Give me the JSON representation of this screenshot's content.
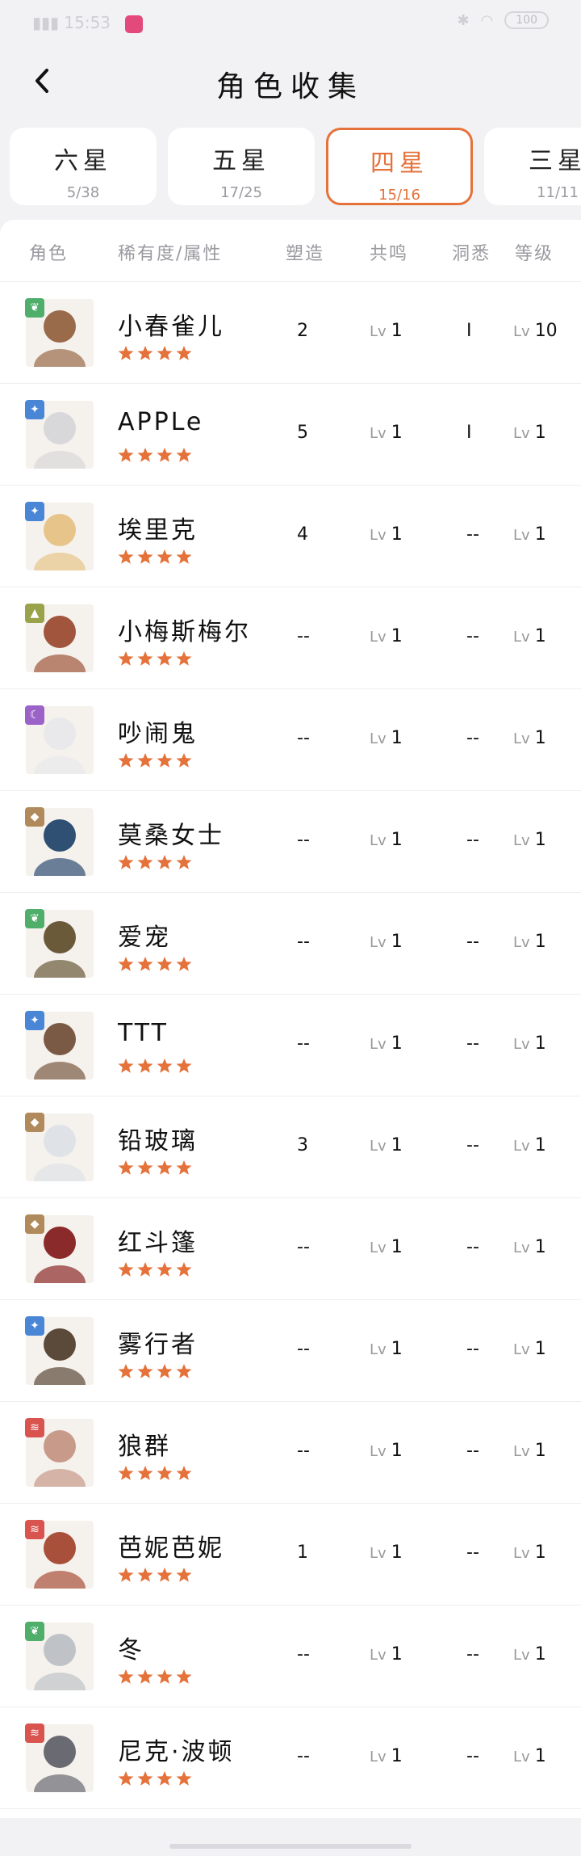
{
  "status_bar": {
    "time": "15:53",
    "battery": "100"
  },
  "header": {
    "title": "角色收集"
  },
  "tabs": [
    {
      "name": "六星",
      "count": "5/38",
      "active": false
    },
    {
      "name": "五星",
      "count": "17/25",
      "active": false
    },
    {
      "name": "四星",
      "count": "15/16",
      "active": true
    },
    {
      "name": "三星",
      "count": "11/11",
      "active": false
    }
  ],
  "table": {
    "headers": [
      "角色",
      "稀有度/属性",
      "塑造",
      "共鸣",
      "洞悉",
      "等级"
    ],
    "rows": [
      {
        "name": "小春雀儿",
        "attr": "plant",
        "attr_color": "#4fae6a",
        "portrait_color": "#9a6b4a",
        "shape": "2",
        "resonance": "1",
        "insight": "I",
        "level": "10"
      },
      {
        "name": "APPLe",
        "attr": "star",
        "attr_color": "#4a86d6",
        "portrait_color": "#d8d8da",
        "shape": "5",
        "resonance": "1",
        "insight": "I",
        "level": "1"
      },
      {
        "name": "埃里克",
        "attr": "star",
        "attr_color": "#4a86d6",
        "portrait_color": "#e7c48a",
        "shape": "4",
        "resonance": "1",
        "insight": "--",
        "level": "1"
      },
      {
        "name": "小梅斯梅尔",
        "attr": "rock",
        "attr_color": "#9aa24a",
        "portrait_color": "#a0553c",
        "shape": "--",
        "resonance": "1",
        "insight": "--",
        "level": "1"
      },
      {
        "name": "吵闹鬼",
        "attr": "moon",
        "attr_color": "#9b62c8",
        "portrait_color": "#e9e9ec",
        "shape": "--",
        "resonance": "1",
        "insight": "--",
        "level": "1"
      },
      {
        "name": "莫桑女士",
        "attr": "mineral",
        "attr_color": "#b08a5a",
        "portrait_color": "#2f4f73",
        "shape": "--",
        "resonance": "1",
        "insight": "--",
        "level": "1"
      },
      {
        "name": "爱宠",
        "attr": "plant",
        "attr_color": "#4fae6a",
        "portrait_color": "#6a5a3a",
        "shape": "--",
        "resonance": "1",
        "insight": "--",
        "level": "1"
      },
      {
        "name": "TTT",
        "attr": "star",
        "attr_color": "#4a86d6",
        "portrait_color": "#7a5a45",
        "shape": "--",
        "resonance": "1",
        "insight": "--",
        "level": "1"
      },
      {
        "name": "铅玻璃",
        "attr": "mineral",
        "attr_color": "#b08a5a",
        "portrait_color": "#dfe3e8",
        "shape": "3",
        "resonance": "1",
        "insight": "--",
        "level": "1"
      },
      {
        "name": "红斗篷",
        "attr": "mineral",
        "attr_color": "#b08a5a",
        "portrait_color": "#8b2a2a",
        "shape": "--",
        "resonance": "1",
        "insight": "--",
        "level": "1"
      },
      {
        "name": "雾行者",
        "attr": "star",
        "attr_color": "#4a86d6",
        "portrait_color": "#5b4a3a",
        "shape": "--",
        "resonance": "1",
        "insight": "--",
        "level": "1"
      },
      {
        "name": "狼群",
        "attr": "beast",
        "attr_color": "#d9534f",
        "portrait_color": "#c89a8a",
        "shape": "--",
        "resonance": "1",
        "insight": "--",
        "level": "1"
      },
      {
        "name": "芭妮芭妮",
        "attr": "beast",
        "attr_color": "#d9534f",
        "portrait_color": "#a8503a",
        "shape": "1",
        "resonance": "1",
        "insight": "--",
        "level": "1"
      },
      {
        "name": "冬",
        "attr": "plant",
        "attr_color": "#4fae6a",
        "portrait_color": "#bfc3c8",
        "shape": "--",
        "resonance": "1",
        "insight": "--",
        "level": "1"
      },
      {
        "name": "尼克·波顿",
        "attr": "beast",
        "attr_color": "#d9534f",
        "portrait_color": "#6a6a72",
        "shape": "--",
        "resonance": "1",
        "insight": "--",
        "level": "1"
      }
    ],
    "rarity_stars": 4,
    "lv_prefix": "Lv"
  },
  "colors": {
    "accent": "#e4723a",
    "star": "#e4723a",
    "muted": "#9a9aa0"
  }
}
